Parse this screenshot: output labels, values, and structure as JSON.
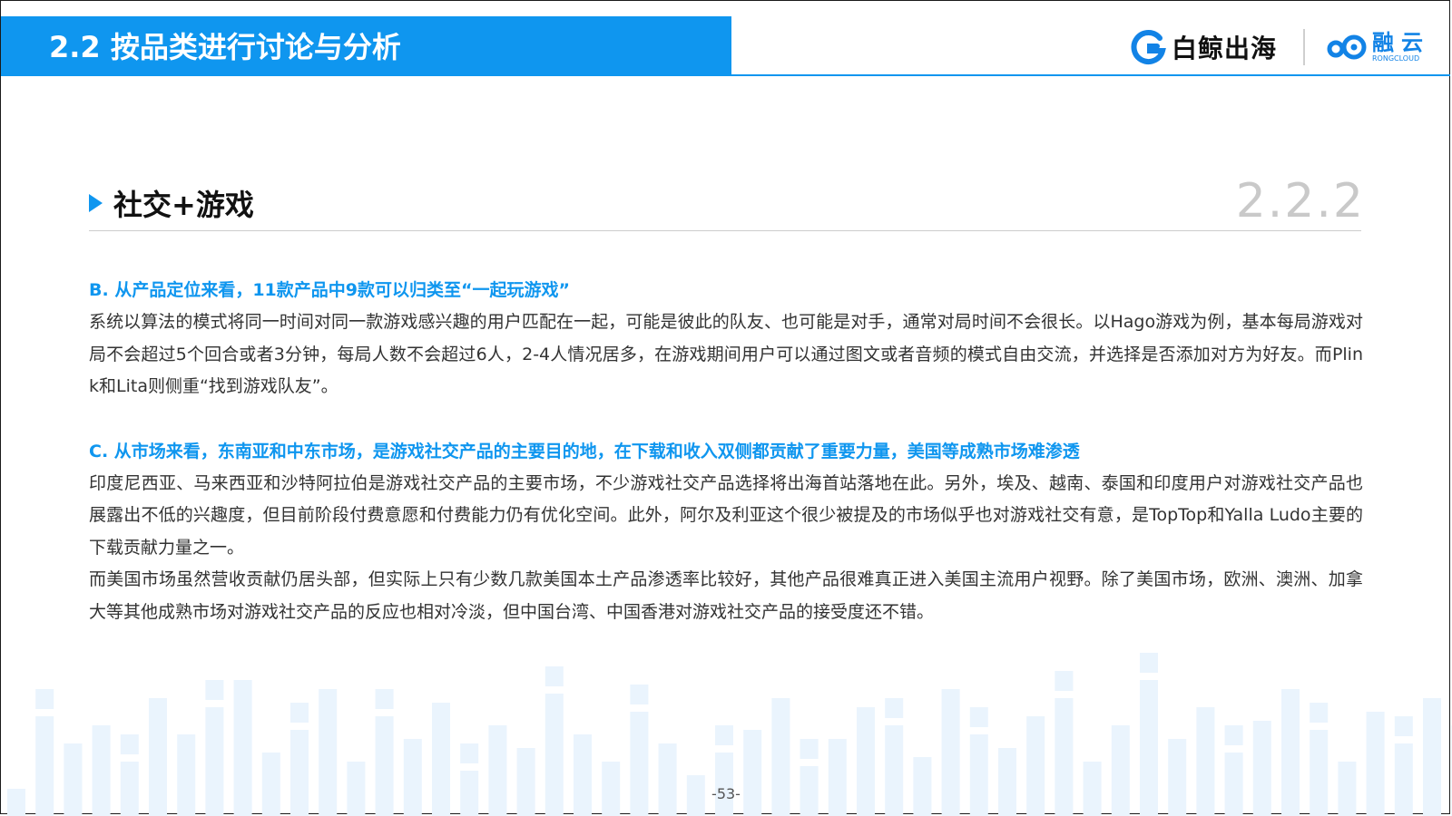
{
  "header": {
    "title": "2.2 按品类进行讨论与分析",
    "logo_baijing": "白鲸出海",
    "logo_rongcloud_cn": "融云",
    "logo_rongcloud_en": "RONGCLOUD"
  },
  "section": {
    "title": "社交+游戏",
    "number": "2.2.2"
  },
  "content": {
    "heading_b": "B. 从产品定位来看，11款产品中9款可以归类至“一起玩游戏”",
    "para_b": "系统以算法的模式将同一时间对同一款游戏感兴趣的用户匹配在一起，可能是彼此的队友、也可能是对手，通常对局时间不会很长。以Hago游戏为例，基本每局游戏对局不会超过5个回合或者3分钟，每局人数不会超过6人，2-4人情况居多，在游戏期间用户可以通过图文或者音频的模式自由交流，并选择是否添加对方为好友。而Plink和Lita则侧重“找到游戏队友”。",
    "heading_c": "C. 从市场来看，东南亚和中东市场，是游戏社交产品的主要目的地，在下载和收入双侧都贡献了重要力量，美国等成熟市场难渗透",
    "para_c1": "印度尼西亚、马来西亚和沙特阿拉伯是游戏社交产品的主要市场，不少游戏社交产品选择将出海首站落地在此。另外，埃及、越南、泰国和印度用户对游戏社交产品也展露出不低的兴趣度，但目前阶段付费意愿和付费能力仍有优化空间。此外，阿尔及利亚这个很少被提及的市场似乎也对游戏社交有意，是TopTop和Yalla Ludo主要的下载贡献力量之一。",
    "para_c2": "而美国市场虽然营收贡献仍居头部，但实际上只有少数几款美国本土产品渗透率比较好，其他产品很难真正进入美国主流用户视野。除了美国市场，欧洲、澳洲、加拿大等其他成熟市场对游戏社交产品的反应也相对冷淡，但中国台湾、中国香港对游戏社交产品的接受度还不错。"
  },
  "footer": {
    "page_number": "-53-"
  },
  "colors": {
    "accent": "#0f96ef",
    "bar_light": "#eaf4fd"
  }
}
